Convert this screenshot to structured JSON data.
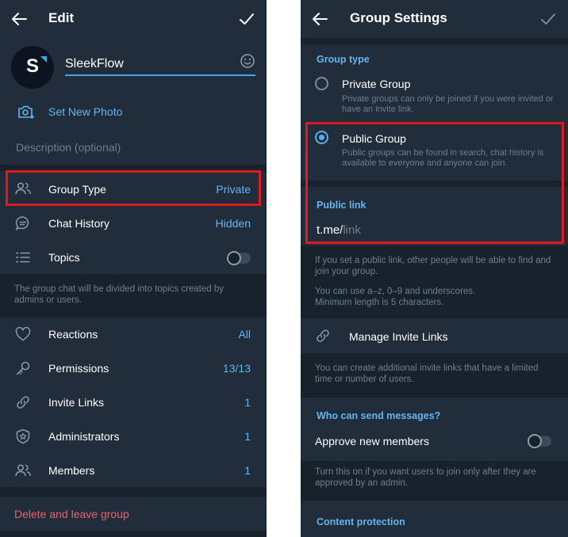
{
  "left_screen": {
    "header": {
      "title": "Edit"
    },
    "group": {
      "avatar_letter": "S",
      "name": "SleekFlow"
    },
    "set_photo_label": "Set New Photo",
    "description_placeholder": "Description (optional)",
    "rows_top": [
      {
        "label": "Group Type",
        "value": "Private",
        "icon": "people-icon"
      },
      {
        "label": "Chat History",
        "value": "Hidden",
        "icon": "chat-bubble-icon"
      },
      {
        "label": "Topics",
        "value": "",
        "icon": "list-icon",
        "toggle": false
      }
    ],
    "topics_note": "The group chat will be divided into topics created by admins or users.",
    "rows_bottom": [
      {
        "label": "Reactions",
        "value": "All",
        "icon": "heart-icon"
      },
      {
        "label": "Permissions",
        "value": "13/13",
        "icon": "key-icon"
      },
      {
        "label": "Invite Links",
        "value": "1",
        "icon": "link-icon"
      },
      {
        "label": "Administrators",
        "value": "1",
        "icon": "star-shield-icon"
      },
      {
        "label": "Members",
        "value": "1",
        "icon": "people-icon"
      }
    ],
    "delete_label": "Delete and leave group"
  },
  "right_screen": {
    "header": {
      "title": "Group Settings"
    },
    "group_type_head": "Group type",
    "private_option": {
      "title": "Private Group",
      "desc": "Private groups can only be joined if you were invited or have an invite link.",
      "selected": false
    },
    "public_option": {
      "title": "Public Group",
      "desc": "Public groups can be found in search, chat history is available to everyone and anyone can join.",
      "selected": true
    },
    "public_link_head": "Public link",
    "link_prefix": "t.me/",
    "link_placeholder": "link",
    "link_note_1": "If you set a public link, other people will be able to find and join your group.",
    "link_note_2": "You can use a–z, 0–9 and underscores. Minimum length is 5 characters.",
    "manage_links_label": "Manage Invite Links",
    "manage_links_note": "You can create additional invite links that have a limited time or number of users.",
    "who_can_send_head": "Who can send messages?",
    "approve_label": "Approve new members",
    "approve_toggle": false,
    "approve_note": "Turn this on if you want users to join only after they are approved by an admin.",
    "content_protection_head": "Content protection"
  },
  "colors": {
    "background": "#18222d",
    "card": "#212d3b",
    "accent": "#64b5ef",
    "muted_text": "#6d7f8f",
    "danger": "#e0656b",
    "highlight_box": "#e0191e"
  }
}
